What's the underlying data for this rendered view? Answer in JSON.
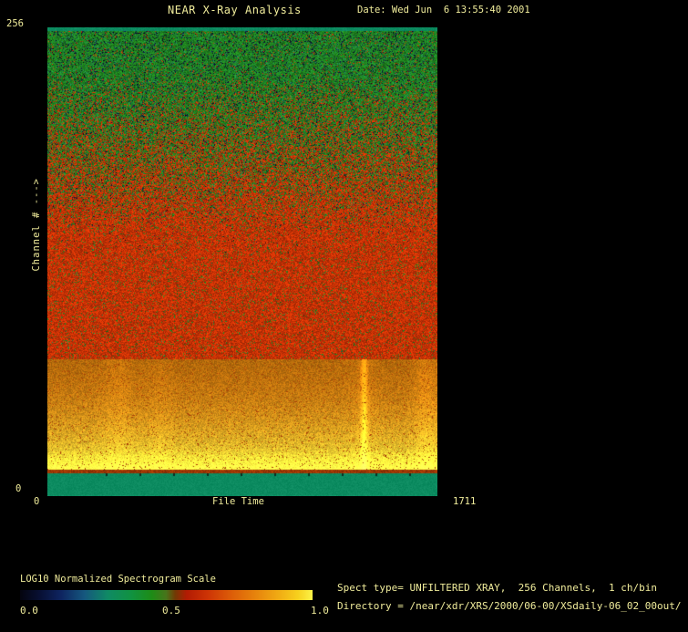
{
  "header": {
    "title": "NEAR X-Ray Analysis",
    "date": "Date: Wed Jun  6 13:55:40 2001"
  },
  "plot": {
    "x_axis": {
      "label": "File Time",
      "min": "0",
      "max": "1711"
    },
    "y_axis": {
      "label": "Channel # --->",
      "min": "0",
      "max": "256"
    }
  },
  "colorbar": {
    "title": "LOG10 Normalized Spectrogram Scale",
    "tick_min": "0.0",
    "tick_mid": "0.5",
    "tick_max": "1.0",
    "gradient": [
      {
        "color": "#04040e",
        "pos": 0
      },
      {
        "color": "#081035",
        "pos": 7
      },
      {
        "color": "#0e2460",
        "pos": 14
      },
      {
        "color": "#15577e",
        "pos": 22
      },
      {
        "color": "#0f8a64",
        "pos": 30
      },
      {
        "color": "#109241",
        "pos": 38
      },
      {
        "color": "#1d8c16",
        "pos": 45
      },
      {
        "color": "#48741b",
        "pos": 50
      },
      {
        "color": "#713a04",
        "pos": 53
      },
      {
        "color": "#b21b03",
        "pos": 57
      },
      {
        "color": "#cd3305",
        "pos": 64
      },
      {
        "color": "#dc5c08",
        "pos": 72
      },
      {
        "color": "#e6810c",
        "pos": 80
      },
      {
        "color": "#f0a913",
        "pos": 88
      },
      {
        "color": "#f7d01d",
        "pos": 95
      },
      {
        "color": "#fcf348",
        "pos": 100
      }
    ]
  },
  "info": {
    "line1": "Spect type= UNFILTERED XRAY,  256 Channels,  1 ch/bin",
    "line2": "Directory = /near/xdr/XRS/2000/06-00/XSdaily-06_02_00out/"
  },
  "colors": {
    "background": "#000000",
    "text": "#f0ec9b",
    "teal_band": "#0c8b60",
    "green_speckle": "#218a21",
    "red_speckle": "#c63203",
    "orange_band": "#d47e0e",
    "yellow_edge": "#f6d33a"
  },
  "chart_data": {
    "type": "heatmap",
    "title": "NEAR X-Ray Analysis",
    "xlabel": "File Time",
    "ylabel": "Channel # --->",
    "xlim": [
      0,
      1711
    ],
    "ylim": [
      0,
      256
    ],
    "colorscale": {
      "label": "LOG10 Normalized Spectrogram Scale",
      "range": [
        0.0,
        1.0
      ]
    },
    "bands": [
      {
        "channels": [
          0,
          12
        ],
        "approx_value": 0.32,
        "appearance": "solid teal strip"
      },
      {
        "channels": [
          12,
          14
        ],
        "approx_value": 0.55,
        "appearance": "thin dark-red separator row"
      },
      {
        "channels": [
          14,
          75
        ],
        "approx_value": 0.85,
        "appearance": "bright orange band, brightening to yellow near channel 15"
      },
      {
        "channels": [
          75,
          140
        ],
        "approx_value": 0.58,
        "appearance": "red speckle"
      },
      {
        "channels": [
          140,
          200
        ],
        "approx_value": 0.48,
        "appearance": "mixed red-green speckle transition"
      },
      {
        "channels": [
          200,
          254
        ],
        "approx_value": 0.4,
        "appearance": "green speckle with sparse dark navy dots"
      },
      {
        "channels": [
          254,
          256
        ],
        "approx_value": 0.32,
        "appearance": "solid teal strip"
      }
    ],
    "events": [
      {
        "file_time": 308,
        "duration": 130,
        "intensity": 0.09
      },
      {
        "file_time": 492,
        "duration": 110,
        "intensity": 0.06
      },
      {
        "file_time": 1388,
        "duration": 26,
        "intensity": 0.5
      },
      {
        "file_time": 1388,
        "duration": 110,
        "intensity": 0.08
      },
      {
        "file_time": 1660,
        "duration": 100,
        "intensity": 0.15
      }
    ]
  }
}
